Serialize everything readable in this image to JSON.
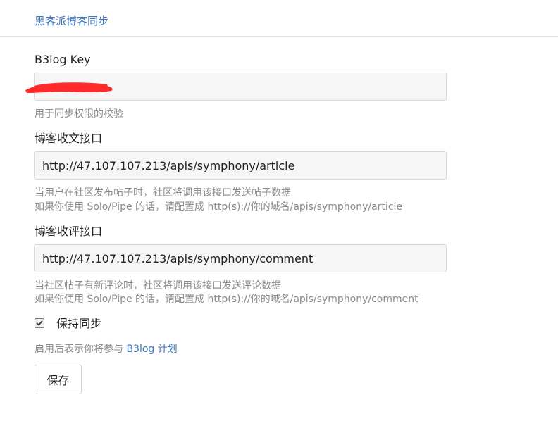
{
  "header": {
    "link_label": "黑客派博客同步"
  },
  "form": {
    "key": {
      "label": "B3log Key",
      "value": "",
      "hint": "用于同步权限的校验"
    },
    "article": {
      "label": "博客收文接口",
      "value": "http://47.107.107.213/apis/symphony/article",
      "hint_line1": "当用户在社区发布帖子时，社区将调用该接口发送帖子数据",
      "hint_line2": "如果你使用 Solo/Pipe 的话，请配置成 http(s)://你的域名/apis/symphony/article"
    },
    "comment": {
      "label": "博客收评接口",
      "value": "http://47.107.107.213/apis/symphony/comment",
      "hint_line1": "当社区帖子有新评论时，社区将调用该接口发送评论数据",
      "hint_line2": "如果你使用 Solo/Pipe 的话，请配置成 http(s)://你的域名/apis/symphony/comment"
    },
    "keep_sync": {
      "label": "保持同步",
      "checked": true
    },
    "join_hint_prefix": "启用后表示你将参与 ",
    "join_hint_link": "B3log 计划",
    "save_label": "保存"
  },
  "colors": {
    "link": "#4078c0",
    "redaction": "#ff2a2a"
  },
  "icons": {
    "checkbox": "check-icon"
  }
}
